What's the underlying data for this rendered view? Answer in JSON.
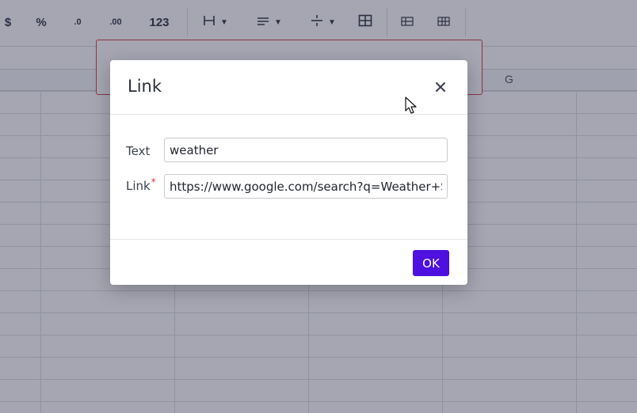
{
  "toolbar": {
    "items": [
      {
        "label": "$",
        "name": "currency-format-button"
      },
      {
        "label": "%",
        "name": "percent-format-button"
      },
      {
        "label": ".0",
        "name": "decrease-decimal-button"
      },
      {
        "label": ".00",
        "name": "increase-decimal-button"
      },
      {
        "label": "123",
        "name": "number-format-button"
      }
    ],
    "icons": [
      "borders-icon",
      "align-icon",
      "divide-icon",
      "table-grid-icon",
      "merge-cells-icon",
      "unmerge-cells-icon"
    ]
  },
  "columns": {
    "visible_letter": "G"
  },
  "dialog": {
    "title": "Link",
    "close_icon": "close-icon",
    "text_label": "Text",
    "text_value": "weather",
    "link_label": "Link",
    "link_required_mark": "*",
    "link_value": "https://www.google.com/search?q=Weather+Sasl",
    "ok_label": "OK"
  },
  "colors": {
    "primary": "#4d10e0",
    "required": "#d23b3b",
    "overlay": "#282c48"
  }
}
